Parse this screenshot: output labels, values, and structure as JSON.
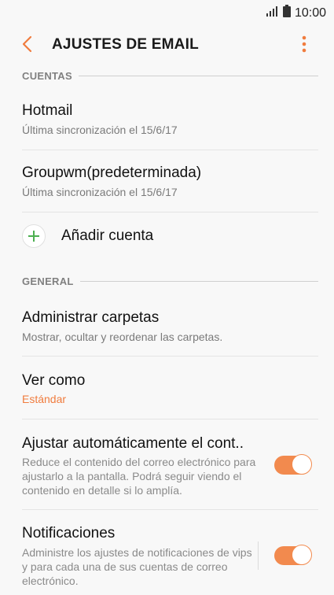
{
  "status": {
    "time": "10:00",
    "signal_icon": "signal-icon",
    "battery_icon": "battery-icon"
  },
  "header": {
    "title": "AJUSTES DE EMAIL",
    "back_icon": "chevron-left-icon",
    "more_icon": "more-vertical-icon"
  },
  "accounts": {
    "section_label": "CUENTAS",
    "items": [
      {
        "name": "Hotmail",
        "sync": "Última sincronización el 15/6/17"
      },
      {
        "name": "Groupwm(predeterminada)",
        "sync": "Última sincronización el 15/6/17"
      }
    ],
    "add_label": "Añadir cuenta"
  },
  "general": {
    "section_label": "GENERAL",
    "manage_folders": {
      "title": "Administrar carpetas",
      "subtitle": "Mostrar, ocultar y reordenar las carpetas."
    },
    "view_as": {
      "title": "Ver como",
      "value": "Estándar"
    },
    "auto_fit": {
      "title": "Ajustar automáticamente el cont..",
      "description": "Reduce el contenido del correo electrónico para ajustarlo a la pantalla. Podrá seguir viendo el contenido en detalle si lo amplía.",
      "enabled": true
    },
    "notifications": {
      "title": "Notificaciones",
      "description": "Administre los ajustes de notificaciones de vips y para cada una de sus cuentas de correo electrónico.",
      "enabled": true
    }
  },
  "colors": {
    "accent": "#f07c3e",
    "toggle_on": "#f28a4e",
    "add_icon": "#4caf50"
  }
}
